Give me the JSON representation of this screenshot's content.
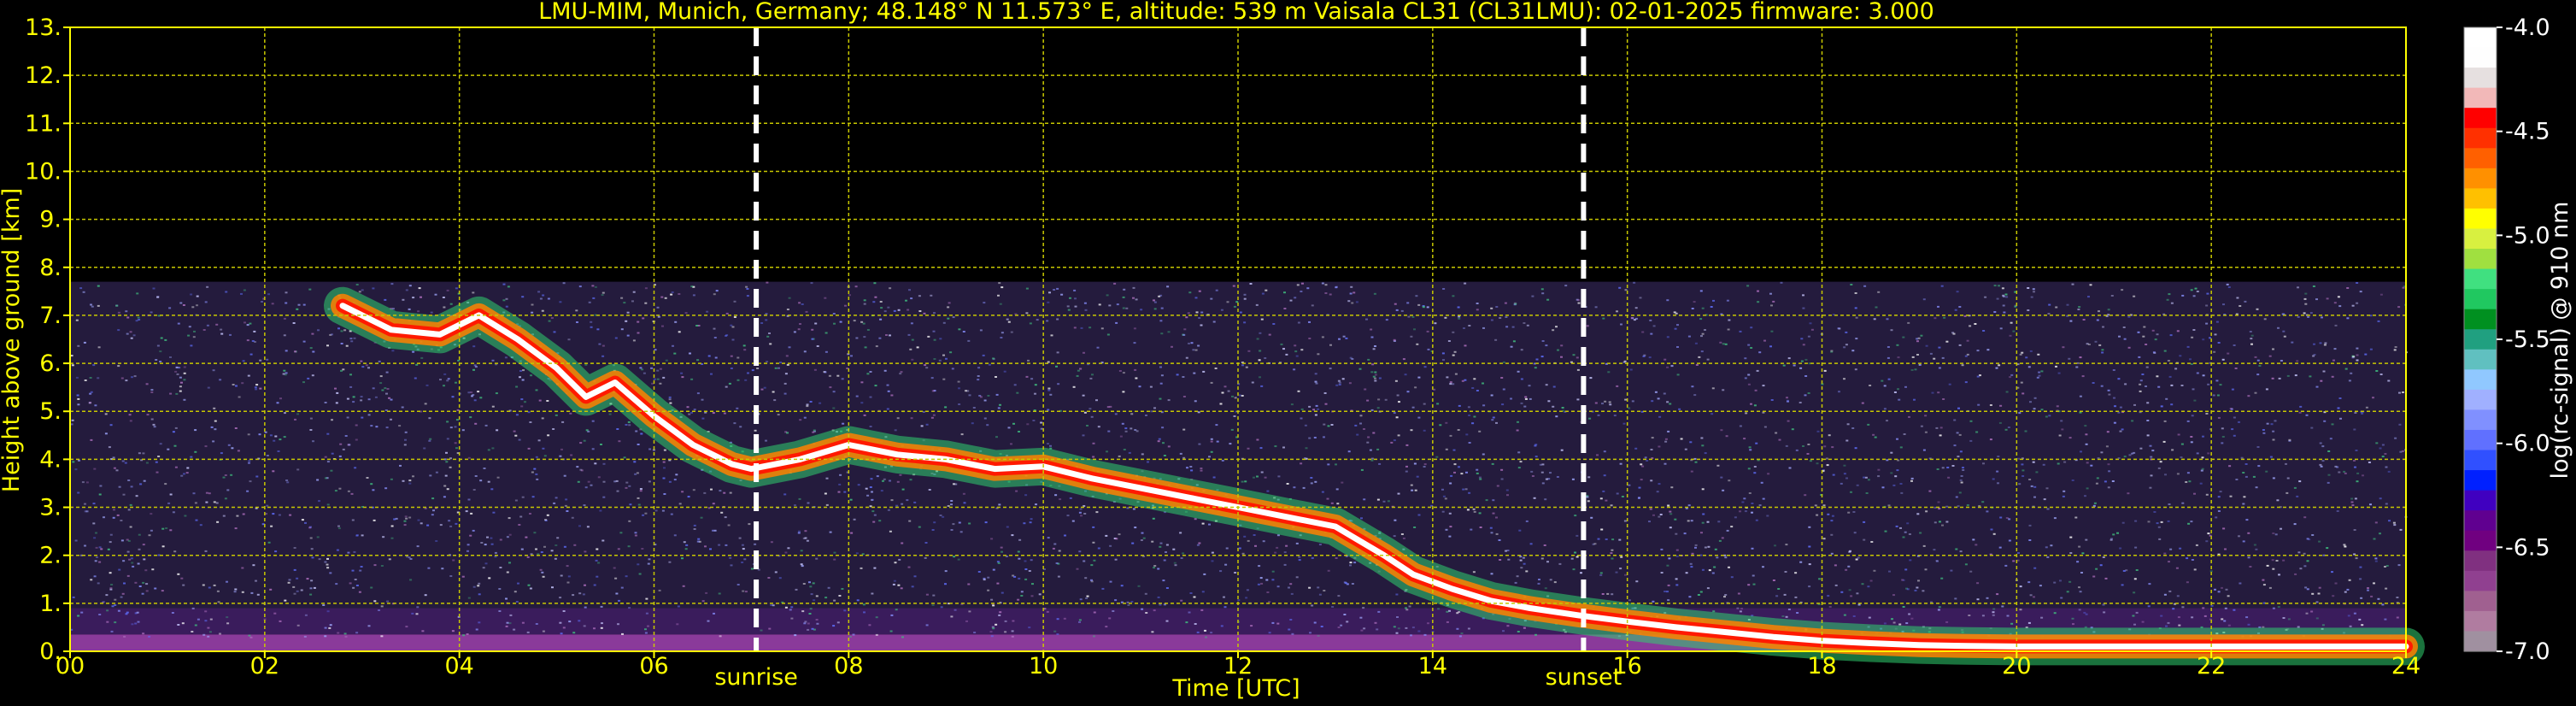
{
  "header": {
    "title": "LMU-MIM, Munich, Germany; 48.148° N 11.573° E, altitude: 539 m    Vaisala CL31 (CL31LMU): 02-01-2025    firmware: 3.000"
  },
  "annotations": {
    "sunrise_label": "sunrise",
    "sunset_label": "sunset"
  },
  "colors": {
    "text": "#ffff00",
    "grid": "#c8c800",
    "background": "#000000"
  },
  "chart_data": {
    "type": "heatmap",
    "title": "LMU-MIM, Munich, Germany; 48.148° N 11.573° E, altitude: 539 m    Vaisala CL31 (CL31LMU): 02-01-2025    firmware: 3.000",
    "xlabel": "Time [UTC]",
    "ylabel": "Height above ground [km]",
    "xlim": [
      0,
      24
    ],
    "ylim": [
      0,
      13
    ],
    "x_ticks": [
      "00",
      "02",
      "04",
      "06",
      "08",
      "10",
      "12",
      "14",
      "16",
      "18",
      "20",
      "22",
      "24"
    ],
    "y_ticks": [
      "0.",
      "1.",
      "2.",
      "3.",
      "4.",
      "5.",
      "6.",
      "7.",
      "8.",
      "9.",
      "10.",
      "11.",
      "12.",
      "13."
    ],
    "grid": true,
    "sunrise_utc": 7.05,
    "sunset_utc": 15.55,
    "sunrise_label": "sunrise",
    "sunset_label": "sunset",
    "noise_top_km": 7.7,
    "cloud_layer": {
      "time_utc": [
        2.8,
        3.3,
        3.8,
        4.2,
        4.6,
        5.0,
        5.3,
        5.6,
        6.0,
        6.4,
        6.8,
        7.0,
        7.5,
        8.0,
        8.5,
        9.0,
        9.5,
        10.0,
        10.5,
        11.0,
        11.5,
        12.0,
        12.5,
        13.0,
        13.5,
        13.8,
        14.2,
        14.6,
        15.0,
        15.5,
        16.0,
        16.5,
        17.0,
        17.5,
        18.0,
        18.5,
        19.0,
        19.5,
        20.0,
        21.0,
        22.0,
        23.0,
        24.0
      ],
      "height_km": [
        7.2,
        6.7,
        6.6,
        7.0,
        6.5,
        5.9,
        5.3,
        5.6,
        4.9,
        4.3,
        3.9,
        3.8,
        4.0,
        4.3,
        4.1,
        4.0,
        3.8,
        3.85,
        3.6,
        3.4,
        3.2,
        3.0,
        2.8,
        2.6,
        2.0,
        1.6,
        1.3,
        1.05,
        0.9,
        0.75,
        0.62,
        0.5,
        0.4,
        0.3,
        0.22,
        0.17,
        0.13,
        0.11,
        0.1,
        0.1,
        0.1,
        0.1,
        0.1
      ]
    },
    "colorbar": {
      "label": "log(rc-signal) @ 910 nm",
      "range": [
        -7.0,
        -4.0
      ],
      "tick_labels": [
        "-4.0",
        "-4.5",
        "-5.0",
        "-5.5",
        "-6.0",
        "-6.5",
        "-7.0"
      ],
      "colors": [
        "#ffffff",
        "#fefefe",
        "#e6e0e0",
        "#f2b8b8",
        "#ff0000",
        "#ff3000",
        "#ff6000",
        "#ff9000",
        "#ffc000",
        "#ffff00",
        "#d8f040",
        "#a0e040",
        "#40e080",
        "#20c860",
        "#009020",
        "#20a080",
        "#60c0c0",
        "#90c8ff",
        "#a0b0ff",
        "#8090ff",
        "#6070ff",
        "#3050ff",
        "#0020ff",
        "#4000c0",
        "#600090",
        "#700080",
        "#803080",
        "#904090",
        "#a06090",
        "#b07ca0",
        "#a090a0"
      ]
    }
  }
}
